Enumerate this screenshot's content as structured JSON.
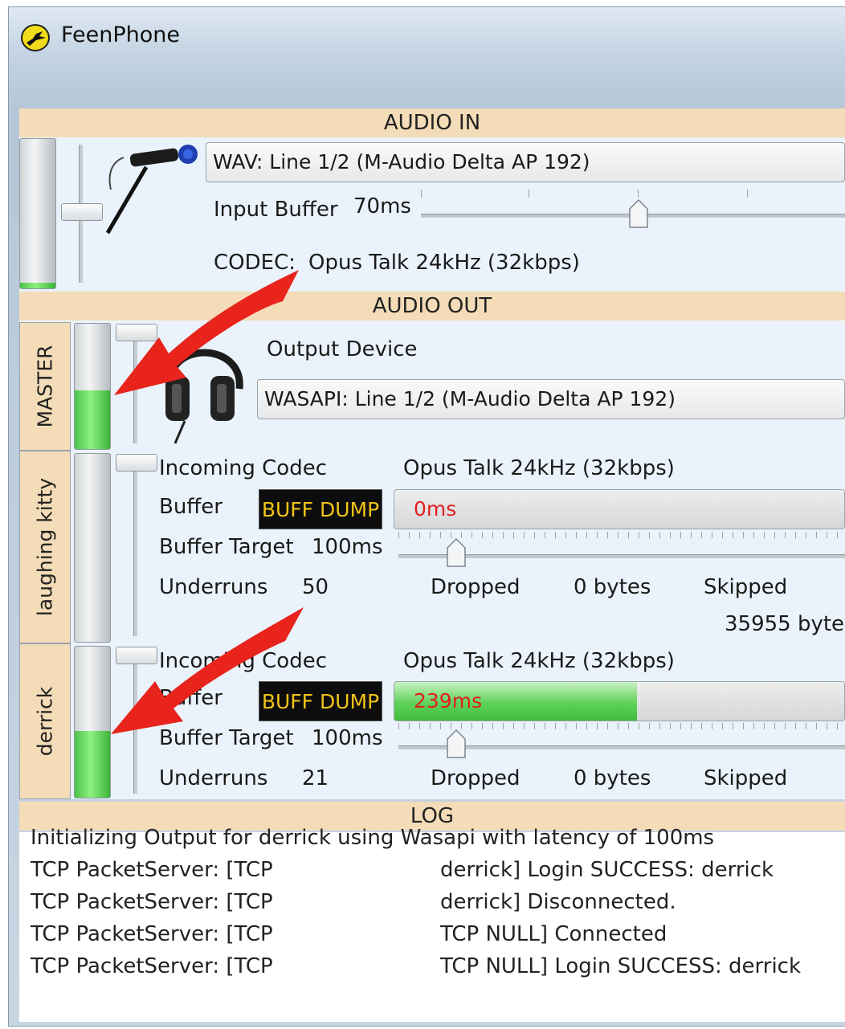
{
  "window": {
    "title": "FeenPhone",
    "app_icon": "bird-logo-icon"
  },
  "audio_in": {
    "header": "AUDIO IN",
    "device": "WAV: Line 1/2 (M-Audio Delta AP 192)",
    "input_buffer_label": "Input Buffer",
    "input_buffer_value": "70ms",
    "codec_label": "CODEC:",
    "codec_value": "Opus Talk 24kHz (32kbps)",
    "meter_level": 0.04,
    "icon": "microphone-icon"
  },
  "audio_out": {
    "header": "AUDIO OUT",
    "master": {
      "tab_label": "MASTER",
      "output_device_label": "Output Device",
      "output_device": "WASAPI: Line 1/2 (M-Audio Delta AP 192)",
      "meter_level": 0.47,
      "icon": "headphones-icon"
    },
    "users": [
      {
        "tab_label": "laughing kitty",
        "incoming_codec_label": "Incoming Codec",
        "incoming_codec": "Opus Talk 24kHz (32kbps)",
        "buffer_label": "Buffer",
        "buff_dump": "BUFF DUMP",
        "buffer_value": "0ms",
        "buffer_fill": 0,
        "buffer_target_label": "Buffer Target",
        "buffer_target": "100ms",
        "underruns_label": "Underruns",
        "underruns": "50",
        "dropped_label": "Dropped",
        "dropped": "0 bytes",
        "skipped_label": "Skipped",
        "skipped": "35955 byte",
        "meter_level": 0.0
      },
      {
        "tab_label": "derrick",
        "incoming_codec_label": "Incoming Codec",
        "incoming_codec": "Opus Talk 24kHz (32kbps)",
        "buffer_label": "Buffer",
        "buff_dump": "BUFF DUMP",
        "buffer_value": "239ms",
        "buffer_fill": 0.54,
        "buffer_target_label": "Buffer Target",
        "buffer_target": "100ms",
        "underruns_label": "Underruns",
        "underruns": "21",
        "dropped_label": "Dropped",
        "dropped": "0 bytes",
        "skipped_label": "Skipped",
        "meter_level": 0.44
      }
    ]
  },
  "log": {
    "header": "LOG",
    "first_line": "Initializing Output for derrick using Wasapi with latency of 100ms",
    "lines": [
      {
        "left": "TCP PacketServer: [TCP",
        "right": "derrick] Login SUCCESS: derrick"
      },
      {
        "left": "TCP PacketServer: [TCP",
        "right": "derrick] Disconnected."
      },
      {
        "left": "TCP PacketServer: [TCP",
        "right": "TCP NULL] Connected"
      },
      {
        "left": "TCP PacketServer: [TCP",
        "right": "TCP NULL] Login SUCCESS: derrick"
      }
    ]
  },
  "annotation_color": "#e8241c"
}
